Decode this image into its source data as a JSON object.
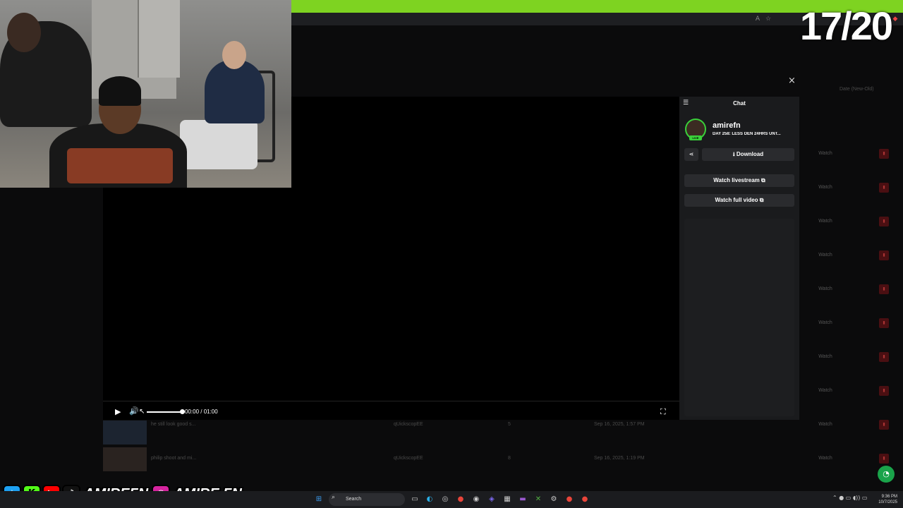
{
  "overlay": {
    "counter": "17/20"
  },
  "page": {
    "sort_label": "Date (New-Old)",
    "watch_label": "Watch",
    "delete_icon": "trash-icon"
  },
  "player": {
    "close_label": "×",
    "time": "00:00 / 01:00",
    "play_icon": "▶",
    "volume_icon": "🔊",
    "fullscreen_icon": "⛶"
  },
  "chat": {
    "title": "Chat",
    "streamer": "amirefn",
    "live_badge": "LIVE",
    "stream_title": "DAY 258: LESS DEN 24HRS UNT...",
    "download_label": "Download",
    "watch_livestream_label": "Watch livestream",
    "watch_full_video_label": "Watch full video",
    "external_icon": "⧉",
    "download_icon": "⭳",
    "share_icon": "⋖"
  },
  "list": [
    {
      "title": "he still look good s...",
      "user": "qUickscopEE",
      "count": "5",
      "date": "Sep 16, 2025, 1:57 PM",
      "watch": "Watch"
    },
    {
      "title": "philip shoot and mi...",
      "user": "qUickscopEE",
      "count": "8",
      "date": "Sep 16, 2025, 1:19 PM",
      "watch": "Watch"
    }
  ],
  "social": {
    "handle_1": "AMIREFN",
    "handle_2": "AMIRE.FN"
  },
  "taskbar": {
    "search_label": "Search",
    "time": "9:36 PM",
    "date": "10/7/2025"
  },
  "colors": {
    "accent_green": "#7ed321",
    "live_green": "#3ad13a",
    "delete_red": "#4a0f12"
  }
}
